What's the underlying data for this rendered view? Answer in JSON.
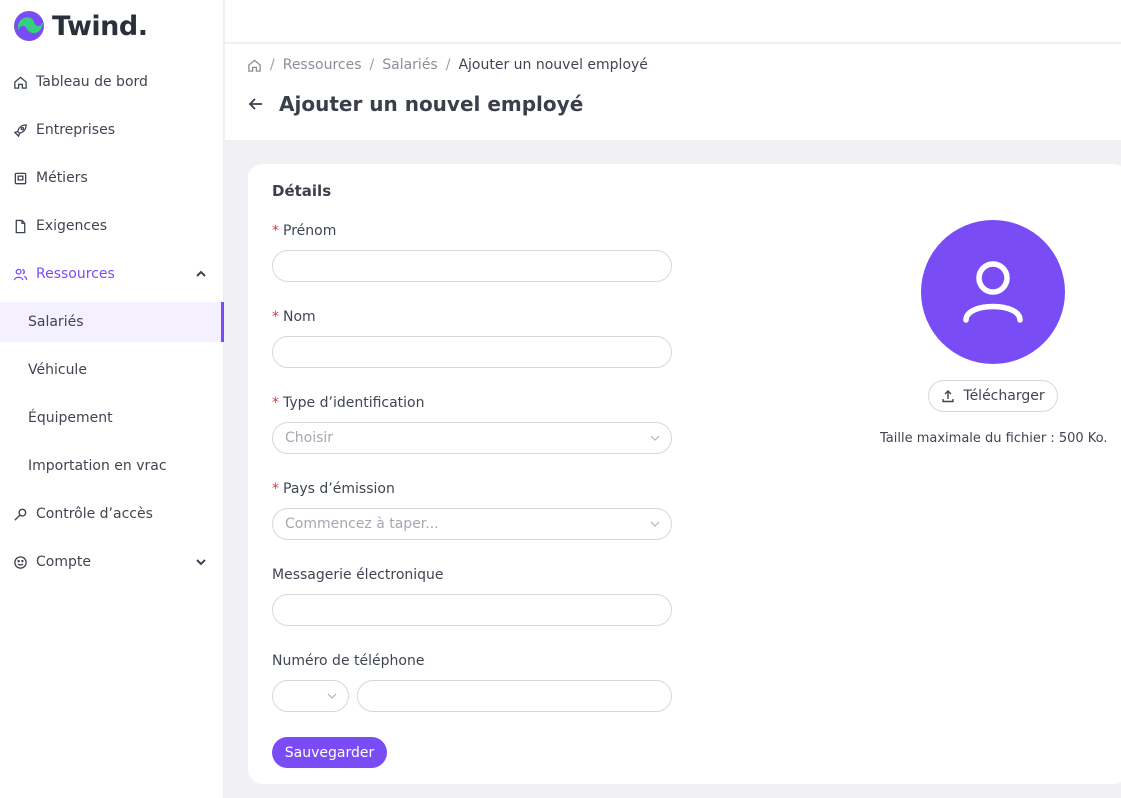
{
  "brand": {
    "name": "Twind.",
    "accent": "#7a4cf5"
  },
  "sidebar": {
    "items": [
      {
        "label": "Tableau de bord",
        "icon": "home-icon"
      },
      {
        "label": "Entreprises",
        "icon": "rocket-icon"
      },
      {
        "label": "Métiers",
        "icon": "clipboard-icon"
      },
      {
        "label": "Exigences",
        "icon": "document-icon"
      },
      {
        "label": "Ressources",
        "icon": "people-icon",
        "expanded": true
      },
      {
        "label": "Contrôle d’accès",
        "icon": "key-icon"
      },
      {
        "label": "Compte",
        "icon": "smiley-icon"
      }
    ],
    "sub_items": [
      {
        "label": "Salariés",
        "active": true
      },
      {
        "label": "Véhicule"
      },
      {
        "label": "Équipement"
      },
      {
        "label": "Importation en vrac"
      }
    ]
  },
  "breadcrumb": {
    "items": [
      "Ressources",
      "Salariés"
    ],
    "current": "Ajouter un nouvel employé"
  },
  "page": {
    "title": "Ajouter un nouvel employé"
  },
  "form": {
    "section_title": "Détails",
    "required_mark": "*",
    "first_name": {
      "label": "Prénom",
      "value": ""
    },
    "last_name": {
      "label": "Nom",
      "value": ""
    },
    "id_type": {
      "label": "Type d’identification",
      "placeholder": "Choisir"
    },
    "country": {
      "label": "Pays d’émission",
      "placeholder": "Commencez à taper..."
    },
    "email": {
      "label": "Messagerie électronique",
      "value": ""
    },
    "phone": {
      "label": "Numéro de téléphone",
      "value": ""
    },
    "save_label": "Sauvegarder"
  },
  "avatar": {
    "upload_label": "Télécharger",
    "note": "Taille maximale du fichier : 500 Ko."
  }
}
